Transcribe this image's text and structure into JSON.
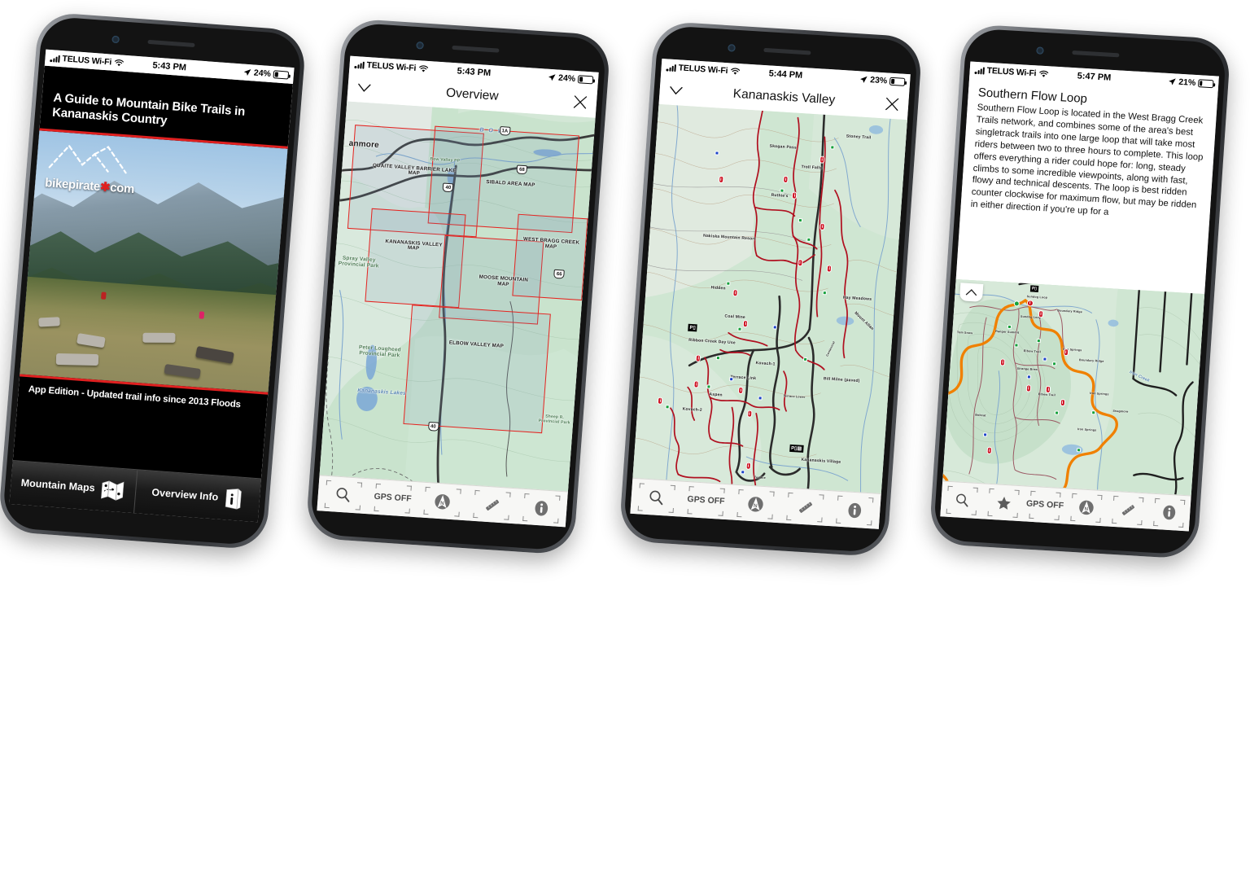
{
  "meta": {
    "accent_red": "#e02020",
    "map_green": "#cfe6d1",
    "route_orange": "#f08000"
  },
  "phone1": {
    "status": {
      "carrier": "TELUS Wi-Fi",
      "time": "5:43 PM",
      "battery": "24%"
    },
    "cover": {
      "title": "A Guide to Mountain Bike Trails in Kananaskis Country",
      "logo_text": "bikepirate",
      "logo_star": "✱",
      "logo_suffix": "com",
      "footer": "App Edition - Updated trail  info since 2013 Floods"
    },
    "tabbar": [
      {
        "label": "Mountain Maps",
        "icon": "folded-map-icon"
      },
      {
        "label": "Overview Info",
        "icon": "info-book-icon"
      }
    ]
  },
  "phone2": {
    "status": {
      "carrier": "TELUS Wi-Fi",
      "time": "5:43 PM",
      "battery": "24%"
    },
    "nav": {
      "left_icon": "chevron-down-icon",
      "title": "Overview",
      "right_icon": "close-icon"
    },
    "map_regions": [
      "QUAITE VALLEY BARRIER LAKE MAP",
      "SIBALD AREA MAP",
      "WEST BRAGG CREEK MAP",
      "KANANASKIS VALLEY MAP",
      "MOOSE MOUNTAIN MAP",
      "ELBOW VALLEY MAP"
    ],
    "map_labels": [
      "anmore",
      "B O W",
      "Bow Valley PP",
      "Spray Valley Provincial Park",
      "Peter Lougheed Provincial Park",
      "Kananaskis Lakes",
      "Sheep R. Provincial Park"
    ],
    "highways": [
      "1A",
      "40",
      "68",
      "66",
      "40"
    ],
    "toolbar": [
      {
        "label": "",
        "icon": "search-icon"
      },
      {
        "label": "GPS OFF",
        "icon": "gps-icon"
      },
      {
        "label": "",
        "icon": "compass-north-icon"
      },
      {
        "label": "",
        "icon": "ruler-icon"
      },
      {
        "label": "",
        "icon": "info-icon"
      }
    ]
  },
  "phone3": {
    "status": {
      "carrier": "TELUS Wi-Fi",
      "time": "5:44 PM",
      "battery": "23%"
    },
    "nav": {
      "left_icon": "chevron-down-icon",
      "title": "Kananaskis Valley",
      "right_icon": "close-icon"
    },
    "trail_labels": [
      "Skogan Pass",
      "Stoney Trail",
      "Troll Falls",
      "Ruthie's",
      "Nakiska Mountain Resort",
      "Hidden",
      "Hay Meadows",
      "Coal Mine",
      "Mount Allan",
      "Ribbon Creek Day Use",
      "Kovach-1",
      "Kovach-2",
      "Terrace Link",
      "Terrace Lower",
      "Aspen",
      "Bill Milne (paved)",
      "Centennial",
      "Kananaskis Village",
      "Terrace"
    ],
    "toolbar": [
      {
        "label": "",
        "icon": "search-icon"
      },
      {
        "label": "GPS OFF",
        "icon": "gps-icon"
      },
      {
        "label": "",
        "icon": "compass-north-icon"
      },
      {
        "label": "",
        "icon": "ruler-icon"
      },
      {
        "label": "",
        "icon": "info-icon"
      }
    ]
  },
  "phone4": {
    "status": {
      "carrier": "TELUS Wi-Fi",
      "time": "5:47 PM",
      "battery": "21%"
    },
    "article": {
      "title": "Southern Flow Loop",
      "body": "Southern Flow Loop is located in the West Bragg Creek Trails network, and combines some of the area's best singletrack trails into one large loop that will take most riders between two to three hours to complete. This loop offers everything a rider could hope for: long, steady climbs to some incredible viewpoints, along with fast, flowy and technical descents. The loop is best ridden counter clockwise for maximum flow, but may be ridden in either direction if you're up for a"
    },
    "collapse_icon": "chevron-up-icon",
    "trail_labels": [
      "Sundog Loop",
      "Boundary Ridge",
      "Ranger Summit",
      "Elbow Trail",
      "Iron Springs",
      "Strange Brew",
      "Bobcat",
      "Snagmore",
      "Iron Creek",
      "Tom Snow",
      "Elbow Trail"
    ],
    "toolbar": [
      {
        "label": "",
        "icon": "search-icon"
      },
      {
        "label": "",
        "icon": "star-icon"
      },
      {
        "label": "GPS OFF",
        "icon": "gps-icon"
      },
      {
        "label": "",
        "icon": "compass-north-icon"
      },
      {
        "label": "",
        "icon": "ruler-icon"
      },
      {
        "label": "",
        "icon": "info-icon"
      }
    ]
  }
}
